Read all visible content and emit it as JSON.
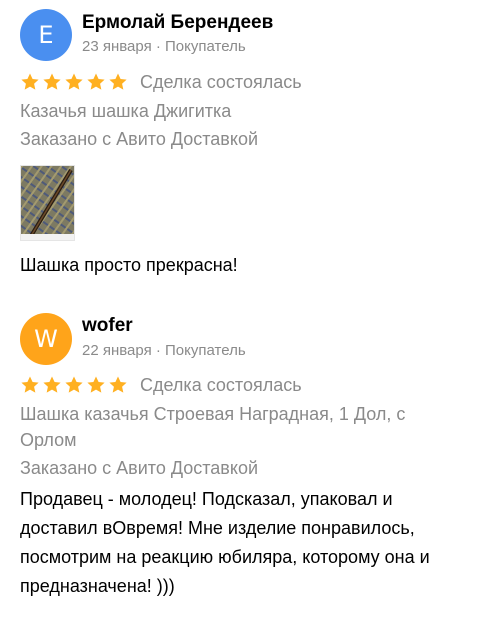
{
  "reviews": [
    {
      "avatar_letter": "E",
      "avatar_color": "#4a8ff0",
      "name": "Ермолай Берендеев",
      "meta": "23 января · Покупатель",
      "rating": 5,
      "deal": "Сделка состоялась",
      "product": "Казачья шашка Джигитка",
      "delivery": "Заказано с Авито Доставкой",
      "text": "Шашка просто прекрасна!"
    },
    {
      "avatar_letter": "W",
      "avatar_color": "#ffa41a",
      "name": "wofer",
      "meta": "22 января · Покупатель",
      "rating": 5,
      "deal": "Сделка состоялась",
      "product_line1": "Шашка казачья Строевая Наградная, 1 Дол, с",
      "product_line2": "Орлом",
      "delivery": "Заказано с Авито Доставкой",
      "text_line1": "Продавец - молодец! Подсказал, упаковал и",
      "text_line2": "доставил вОвремя! Мне изделие понравилось,",
      "text_line3": "посмотрим на реакцию юбиляра, которому она и",
      "text_line4": "предназначена! )))"
    }
  ],
  "colors": {
    "star": "#ffb021",
    "muted": "#8a8a8a"
  }
}
